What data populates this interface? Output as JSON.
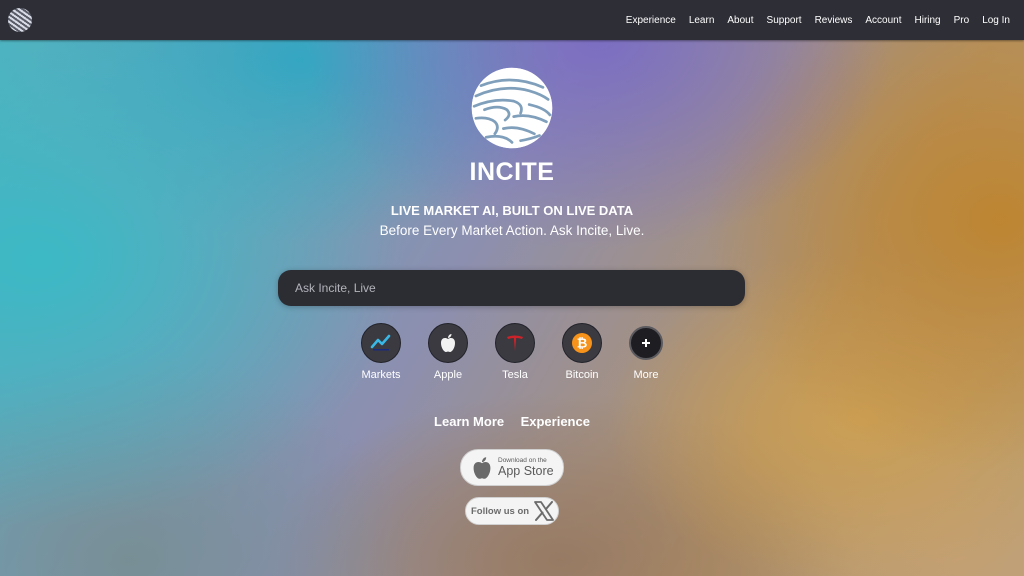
{
  "topbar": {
    "nav": [
      "Experience",
      "Learn",
      "About",
      "Support",
      "Reviews",
      "Account",
      "Hiring",
      "Pro",
      "Log In"
    ]
  },
  "hero": {
    "brand": "INCITE",
    "tagline": "LIVE MARKET AI, BUILT ON LIVE DATA",
    "subtagline": "Before Every Market Action. Ask Incite, Live."
  },
  "search": {
    "placeholder": "Ask Incite, Live"
  },
  "quick_actions": [
    {
      "label": "Markets",
      "icon": "markets-chart-icon"
    },
    {
      "label": "Apple",
      "icon": "apple-icon"
    },
    {
      "label": "Tesla",
      "icon": "tesla-icon"
    },
    {
      "label": "Bitcoin",
      "icon": "bitcoin-icon"
    },
    {
      "label": "More",
      "icon": "plus-icon"
    }
  ],
  "links": {
    "learn_more": "Learn More",
    "experience": "Experience"
  },
  "badges": {
    "app_store_small": "Download on the",
    "app_store_big": "App Store",
    "follow_text": "Follow us on"
  },
  "colors": {
    "topbar": "#2e2e36",
    "search_bg": "#2c2c33",
    "bitcoin": "#f7931a",
    "tesla": "#cc2229"
  }
}
